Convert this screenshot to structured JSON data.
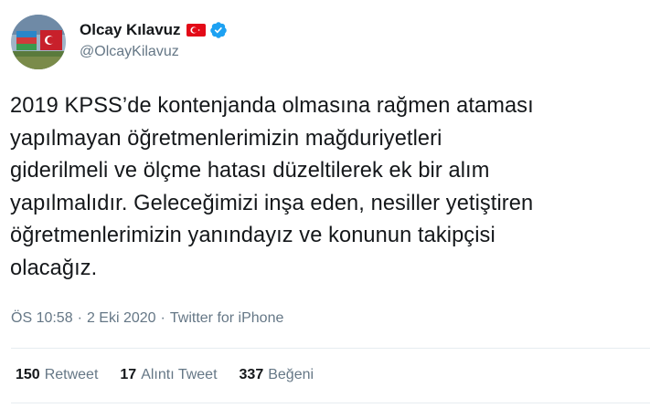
{
  "author": {
    "display_name": "Olcay Kılavuz",
    "handle": "@OlcayKilavuz",
    "flag_icon": "turkey-flag-icon",
    "verified_icon": "verified-badge-icon"
  },
  "tweet": {
    "text_lines": [
      "2019 KPSS’de kontenjanda olmasına rağmen ataması",
      "yapılmayan öğretmenlerimizin mağduriyetleri",
      "giderilmeli ve ölçme hatası düzeltilerek ek bir alım",
      "yapılmalıdır. Geleceğimizi inşa eden, nesiller yetiştiren",
      "öğretmenlerimizin yanındayız ve konunun takipçisi",
      "olacağız."
    ],
    "time": "ÖS 10:58",
    "separator": "·",
    "date": "2 Eki 2020",
    "source": "Twitter for iPhone"
  },
  "stats": {
    "retweets": {
      "count": "150",
      "label": "Retweet"
    },
    "quotes": {
      "count": "17",
      "label": "Alıntı Tweet"
    },
    "likes": {
      "count": "337",
      "label": "Beğeni"
    }
  },
  "colors": {
    "text": "#14171a",
    "secondary": "#657786",
    "verified": "#1da1f2",
    "flag_red": "#e30a17",
    "divider": "#e6ecf0"
  }
}
